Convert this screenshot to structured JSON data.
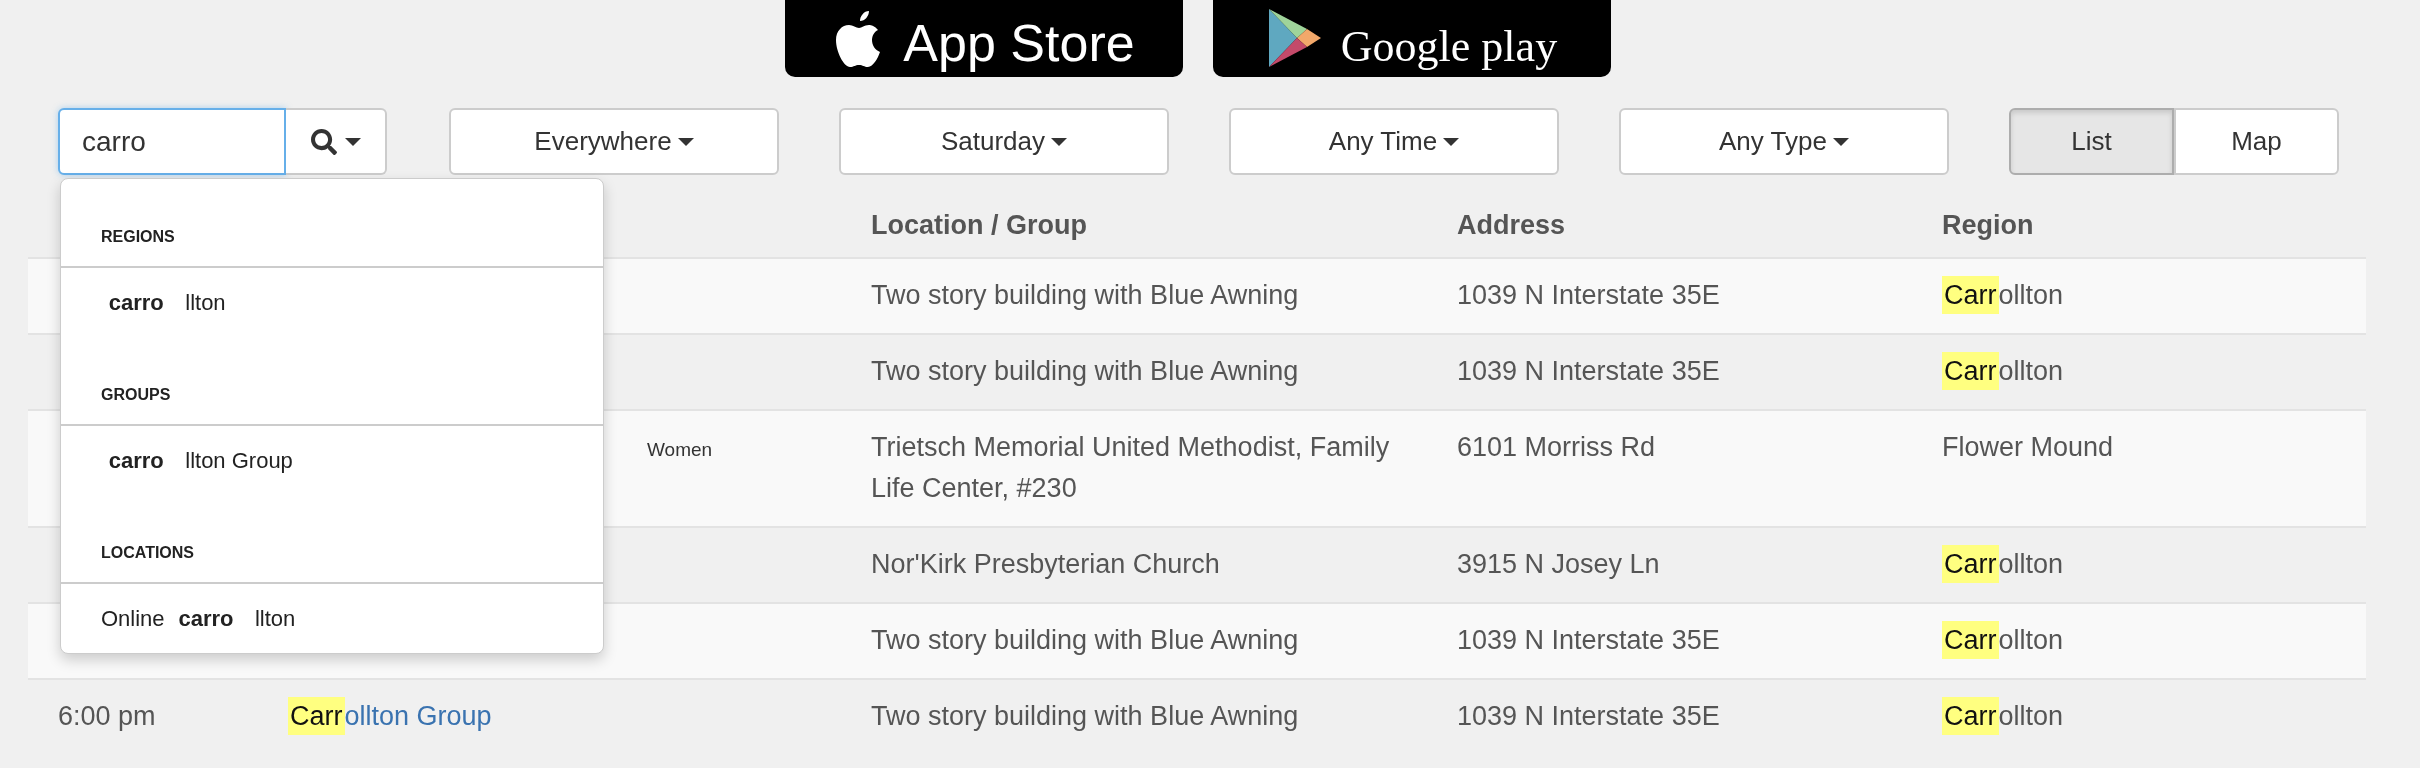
{
  "badges": [
    {
      "kind": "apple",
      "label": "App Store"
    },
    {
      "kind": "google",
      "label": "Google play"
    }
  ],
  "search": {
    "value": "carro"
  },
  "filters": [
    {
      "label": "Everywhere"
    },
    {
      "label": "Saturday"
    },
    {
      "label": "Any Time"
    },
    {
      "label": "Any Type"
    }
  ],
  "views": [
    {
      "label": "List",
      "selected": true
    },
    {
      "label": "Map",
      "selected": false
    }
  ],
  "table": {
    "columns": [
      "Location / Group",
      "Address",
      "Region"
    ],
    "rows": [
      {
        "location": "Two story building with Blue Awning",
        "address": "1039 N Interstate 35E",
        "region": {
          "match": "Carr",
          "rest": "ollton"
        }
      },
      {
        "location": "Two story building with Blue Awning",
        "address": "1039 N Interstate 35E",
        "region": {
          "match": "Carr",
          "rest": "ollton"
        }
      },
      {
        "tag": "Women",
        "location": "Trietsch Memorial United Methodist, Family Life Center, #230",
        "address": "6101 Morriss Rd",
        "region": {
          "rest": "Flower Mound"
        }
      },
      {
        "location": "Nor'Kirk Presbyterian Church",
        "address": "3915 N Josey Ln",
        "region": {
          "match": "Carr",
          "rest": "ollton"
        }
      },
      {
        "location": "Two story building with Blue Awning",
        "address": "1039 N Interstate 35E",
        "region": {
          "match": "Carr",
          "rest": "ollton"
        }
      },
      {
        "time": "6:00 pm",
        "meeting": {
          "match": "Carr",
          "rest": "ollton Group"
        },
        "location": "Two story building with Blue Awning",
        "address": "1039 N Interstate 35E",
        "region": {
          "match": "Carr",
          "rest": "ollton"
        }
      }
    ]
  },
  "suggestions": [
    {
      "heading": "REGIONS",
      "items": [
        "**carro** llton"
      ]
    },
    {
      "heading": "GROUPS",
      "items": [
        "**carro** llton Group"
      ]
    },
    {
      "heading": "LOCATIONS",
      "items": [
        "Online **carro** llton"
      ]
    }
  ]
}
